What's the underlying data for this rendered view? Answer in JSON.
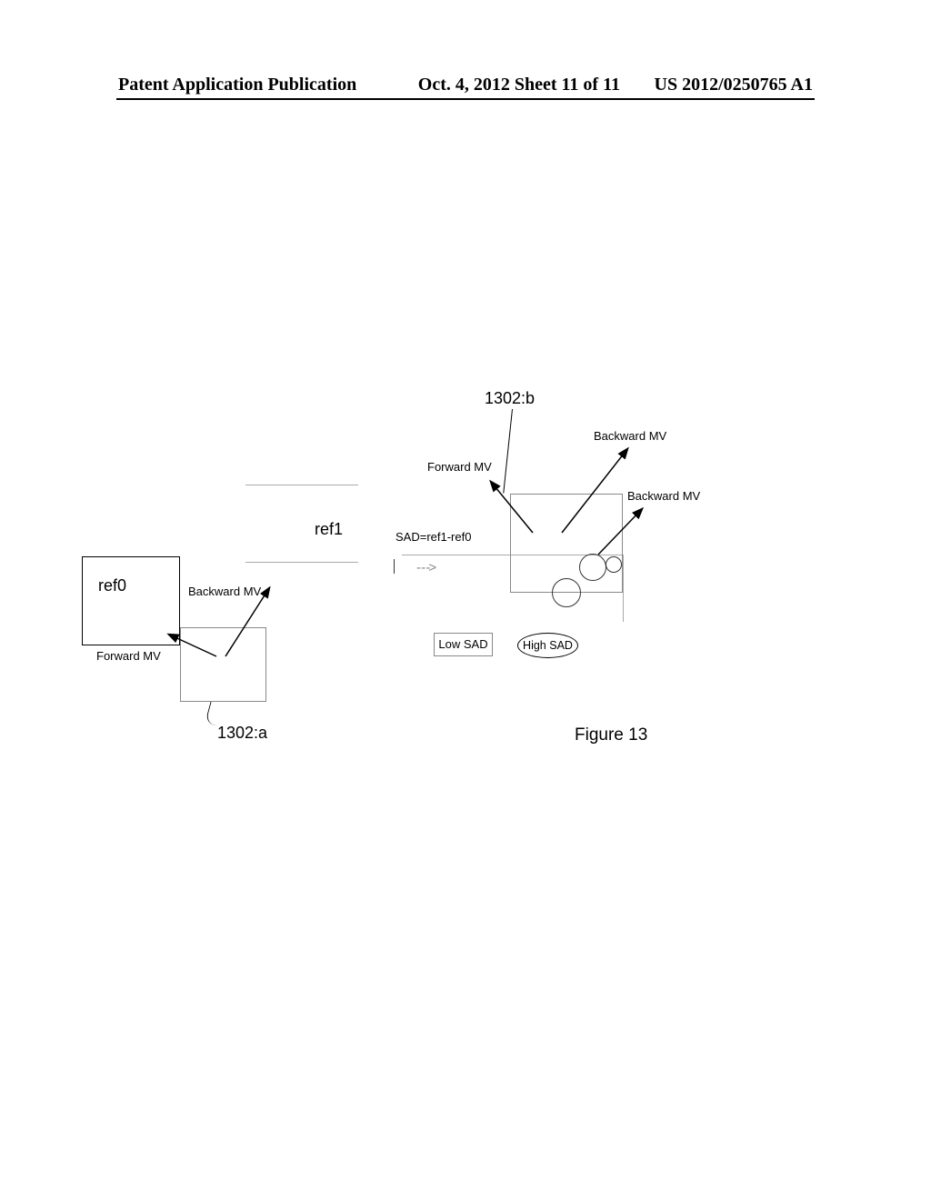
{
  "header": {
    "left": "Patent Application Publication",
    "center": "Oct. 4, 2012   Sheet 11 of 11",
    "right": "US 2012/0250765 A1"
  },
  "labels": {
    "ref0": "ref0",
    "ref1": "ref1",
    "a_callout": "1302:a",
    "b_callout": "1302:b",
    "forward_mv": "Forward MV",
    "backward_mv": "Backward MV",
    "sad_formula": "SAD=ref1-ref0",
    "low_sad": "Low SAD",
    "high_sad": "High SAD",
    "figure": "Figure 13"
  }
}
